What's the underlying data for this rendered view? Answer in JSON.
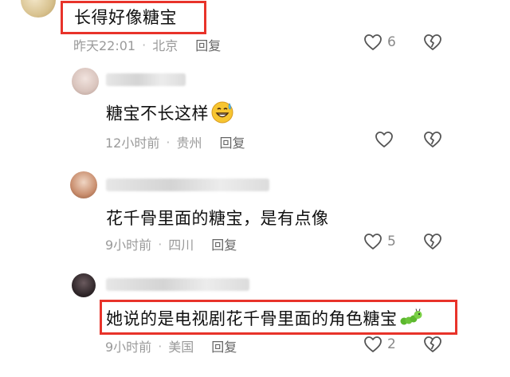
{
  "comments": [
    {
      "text": "长得好像糖宝",
      "time": "昨天22:01",
      "location": "北京",
      "reply": "回复",
      "likes": "6"
    },
    {
      "text": "糖宝不长这样",
      "time": "12小时前",
      "location": "贵州",
      "reply": "回复",
      "likes": ""
    },
    {
      "text": "花千骨里面的糖宝，是有点像",
      "time": "9小时前",
      "location": "四川",
      "reply": "回复",
      "likes": "5"
    },
    {
      "text": "她说的是电视剧花千骨里面的角色糖宝",
      "time": "9小时前",
      "location": "美国",
      "reply": "回复",
      "likes": "2"
    }
  ],
  "separator": "·",
  "colors": {
    "highlight": "#e8332a",
    "meta": "#9a9a9a",
    "text": "#111111"
  }
}
